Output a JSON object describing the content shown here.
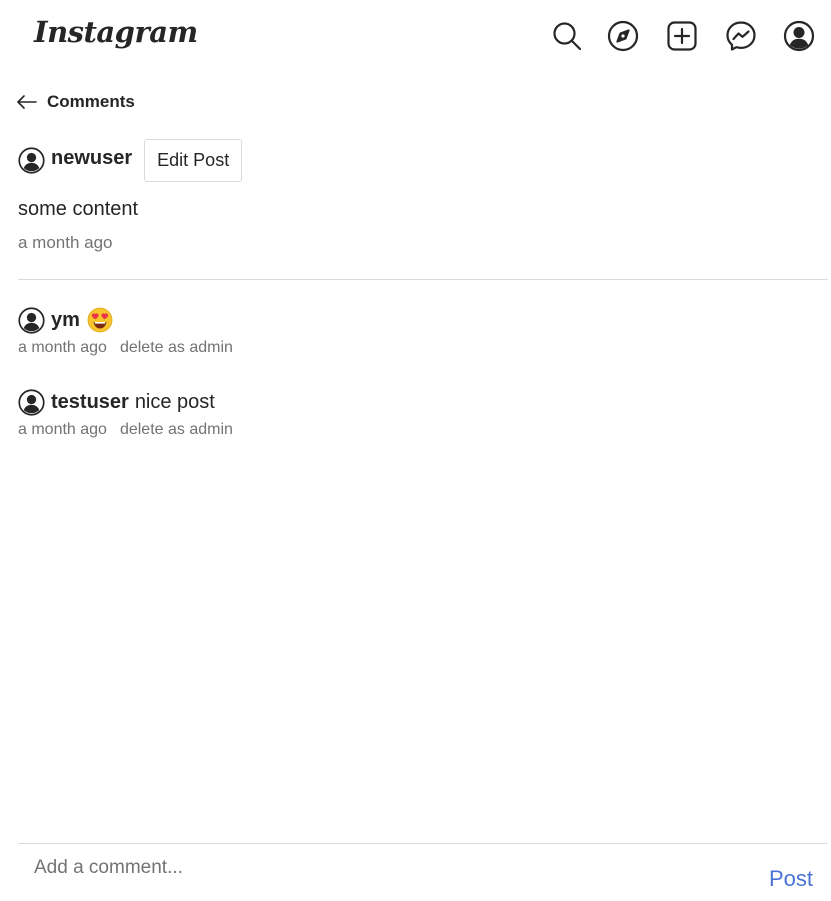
{
  "header": {
    "logo_text": "Instagram",
    "icons": [
      "search-icon",
      "explore-icon",
      "new-post-icon",
      "messenger-icon",
      "profile-icon"
    ]
  },
  "page_title": "Comments",
  "post": {
    "username": "newuser",
    "edit_label": "Edit Post",
    "content": "some content",
    "time": "a month ago"
  },
  "comments": [
    {
      "username": "ym",
      "text": "",
      "emoji": "heart-eyes-emoji",
      "time": "a month ago",
      "delete_label": "delete as admin"
    },
    {
      "username": "testuser",
      "text": "nice post",
      "time": "a month ago",
      "delete_label": "delete as admin"
    }
  ],
  "comment_form": {
    "placeholder": "Add a comment...",
    "submit_label": "Post"
  },
  "colors": {
    "text": "#262626",
    "muted": "#737373",
    "border": "#dbdbdb",
    "link": "#4a73d6"
  }
}
